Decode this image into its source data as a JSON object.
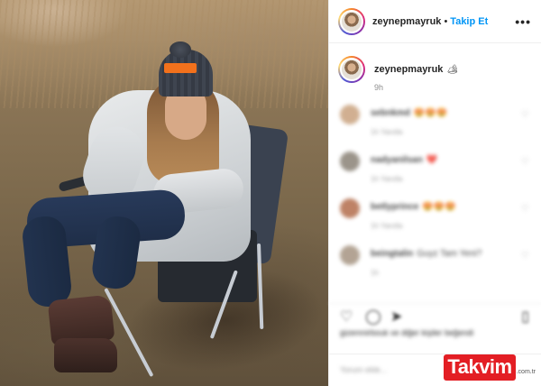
{
  "post": {
    "author": {
      "username": "zeynepmayruk",
      "follow_label": "Takip Et",
      "separator": "•"
    },
    "caption": {
      "username": "zeynepmayruk",
      "emoji": "🏕"
    },
    "time": "9h",
    "more_label": "•••",
    "photo": {
      "beanie_text": "BEARS"
    },
    "comments": [
      {
        "user": "sebnkmd",
        "text": "😍😍😍",
        "meta": "1h   Yanıtla",
        "avatar_color": "#c9a27e"
      },
      {
        "user": "nadyanilsan",
        "text": "❤️",
        "meta": "1h   Yanıtla",
        "avatar_color": "#8a8276"
      },
      {
        "user": "betlyprince",
        "text": "😍😍😍",
        "meta": "1h   Yanıtla",
        "avatar_color": "#b36d4c"
      },
      {
        "user": "beingtalin",
        "text": "Guyz Tam Yeni?",
        "meta": "1h",
        "avatar_color": "#a69482"
      }
    ],
    "actions": {
      "like_icon": "heart-icon",
      "comment_icon": "comment-icon",
      "share_icon": "share-icon",
      "save_icon": "bookmark-icon"
    },
    "likes_text": "gizemnirbouk ve diğer kişiler beğendi",
    "add_comment_placeholder": "Yorum ekle..."
  },
  "watermark": {
    "brand": "Takvim",
    "tld": ".com.tr",
    "color": "#e31e24"
  }
}
